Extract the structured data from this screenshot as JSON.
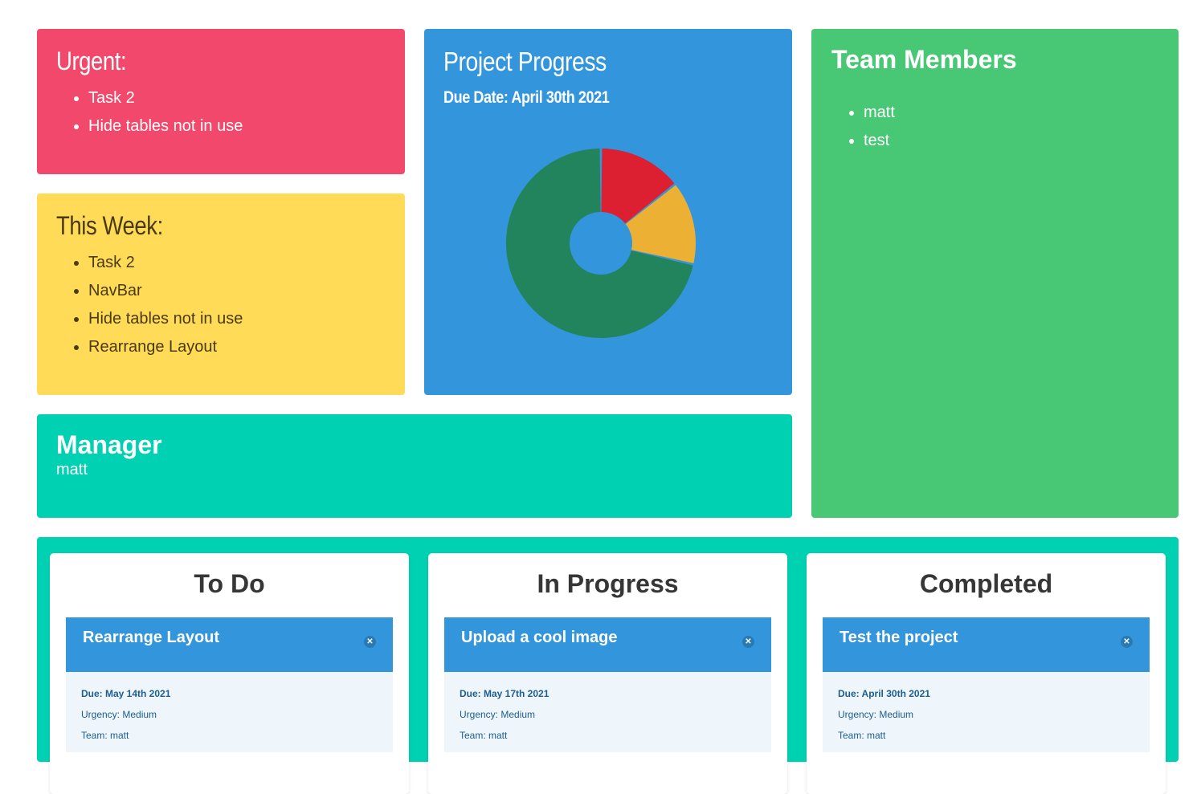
{
  "urgent": {
    "title": "Urgent:",
    "items": [
      "Task 2",
      "Hide tables not in use"
    ]
  },
  "week": {
    "title": "This Week:",
    "items": [
      "Task 2",
      "NavBar",
      "Hide tables not in use",
      "Rearrange Layout"
    ]
  },
  "progress": {
    "title": "Project Progress",
    "due": "Due Date: April 30th 2021"
  },
  "chart_data": {
    "type": "pie",
    "values": [
      1,
      1,
      5
    ],
    "colors": [
      "#dc1f31",
      "#ecb035",
      "#21845c"
    ]
  },
  "team": {
    "title": "Team Members",
    "members": [
      "matt",
      "test"
    ]
  },
  "manager": {
    "title": "Manager",
    "name": "matt"
  },
  "board": {
    "columns": [
      {
        "title": "To Do",
        "task": {
          "title": "Rearrange Layout",
          "due": "Due: May 14th 2021",
          "urgency": "Urgency: Medium",
          "team": "Team: matt"
        }
      },
      {
        "title": "In Progress",
        "task": {
          "title": "Upload a cool image",
          "due": "Due: May 17th 2021",
          "urgency": "Urgency: Medium",
          "team": "Team: matt"
        }
      },
      {
        "title": "Completed",
        "task": {
          "title": "Test the project",
          "due": "Due: April 30th 2021",
          "urgency": "Urgency: Medium",
          "team": "Team: matt"
        }
      }
    ],
    "delete_glyph": "✕"
  }
}
